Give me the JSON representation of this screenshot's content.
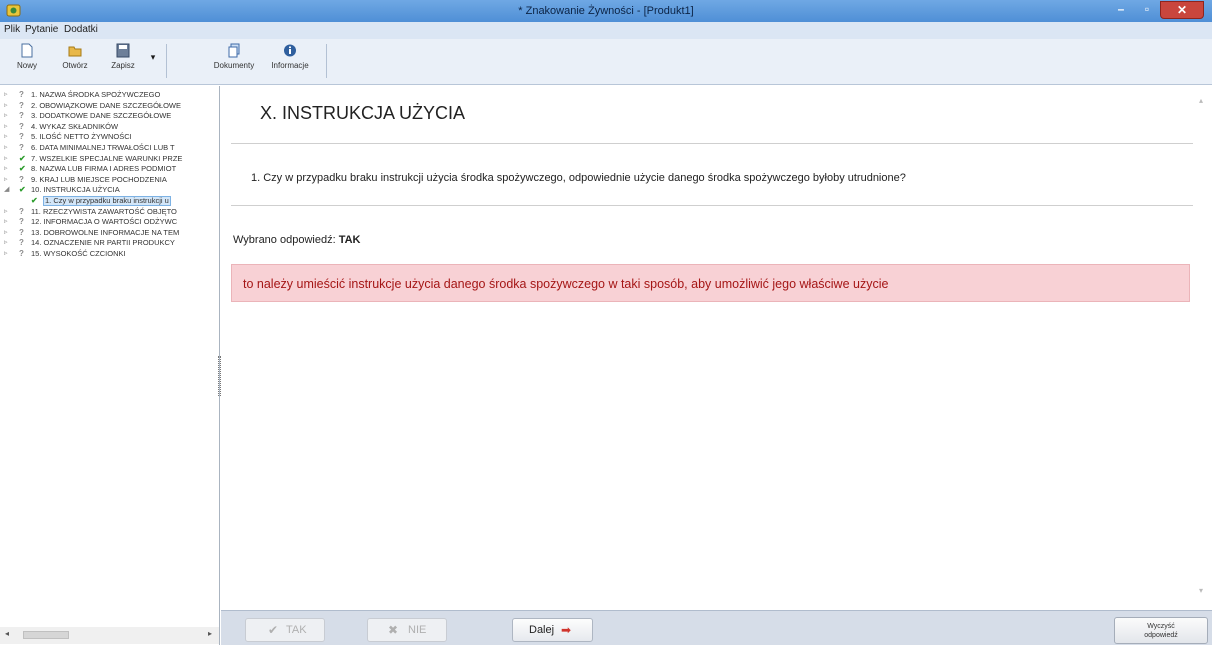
{
  "window": {
    "title": "* Znakowanie Żywności - [Produkt1]",
    "app_icon": "app-icon",
    "minimize": "–",
    "maximize": "▫",
    "close": "✕"
  },
  "menu": {
    "items": [
      "Plik",
      "Pytanie",
      "Dodatki"
    ]
  },
  "toolbar": {
    "buttons": [
      {
        "label": "Nowy",
        "icon": "new-document-icon"
      },
      {
        "label": "Otwórz",
        "icon": "open-folder-icon"
      },
      {
        "label": "Zapisz",
        "icon": "save-icon"
      },
      {
        "label": "Dokumenty",
        "icon": "documents-icon"
      },
      {
        "label": "Informacje",
        "icon": "info-icon"
      }
    ],
    "save_dropdown": "▾"
  },
  "tree": {
    "items": [
      {
        "expander": "▹",
        "mark": "?",
        "status": "q",
        "text": "1. NAZWA ŚRODKA SPOŻYWCZEGO"
      },
      {
        "expander": "▹",
        "mark": "?",
        "status": "q",
        "text": "2. OBOWIĄZKOWE DANE SZCZEGÓŁOWE"
      },
      {
        "expander": "▹",
        "mark": "?",
        "status": "q",
        "text": "3. DODATKOWE DANE SZCZEGÓŁOWE"
      },
      {
        "expander": "▹",
        "mark": "?",
        "status": "q",
        "text": "4. WYKAZ SKŁADNIKÓW"
      },
      {
        "expander": "▹",
        "mark": "?",
        "status": "q",
        "text": "5. ILOŚĆ NETTO ŻYWNOŚCI"
      },
      {
        "expander": "▹",
        "mark": "?",
        "status": "q",
        "text": "6. DATA MINIMALNEJ TRWAŁOŚCI LUB T"
      },
      {
        "expander": "▹",
        "mark": "✔",
        "status": "ok",
        "text": "7. WSZELKIE SPECJALNE WARUNKI PRZE"
      },
      {
        "expander": "▹",
        "mark": "✔",
        "status": "ok",
        "text": "8. NAZWA LUB FIRMA I ADRES PODMIOT"
      },
      {
        "expander": "▹",
        "mark": "?",
        "status": "q",
        "text": "9. KRAJ LUB MIEJSCE POCHODZENIA"
      },
      {
        "expander": "◢",
        "mark": "✔",
        "status": "ok",
        "text": "10. INSTRUKCJA UŻYCIA"
      },
      {
        "expander": "",
        "mark": "✔",
        "status": "ok",
        "text": "1. Czy w przypadku braku instrukcji u",
        "child": true,
        "selected": true
      },
      {
        "expander": "▹",
        "mark": "?",
        "status": "q",
        "text": "11. RZECZYWISTA ZAWARTOŚĆ OBJĘTO"
      },
      {
        "expander": "▹",
        "mark": "?",
        "status": "q",
        "text": "12. INFORMACJA O WARTOŚCI ODŻYWC"
      },
      {
        "expander": "▹",
        "mark": "?",
        "status": "q",
        "text": "13. DOBROWOLNE INFORMACJE NA TEM"
      },
      {
        "expander": "▹",
        "mark": "?",
        "status": "q",
        "text": "14. OZNACZENIE NR PARTII PRODUKCY"
      },
      {
        "expander": "▹",
        "mark": "?",
        "status": "q",
        "text": "15. WYSOKOŚĆ CZCIONKI"
      }
    ],
    "scroll_left": "◂",
    "scroll_right": "▸"
  },
  "content": {
    "heading": "X. INSTRUKCJA UŻYCIA",
    "question": "1.  Czy w przypadku braku instrukcji użycia środka spożywczego, odpowiednie użycie danego środka spożywczego byłoby utrudnione?",
    "answer_label": "Wybrano odpowiedź: ",
    "answer_value": "TAK",
    "result": "to należy umieścić instrukcje użycia danego środka spożywczego w taki sposób, aby umożliwić jego właściwe użycie",
    "scroll_up": "▴",
    "scroll_down": "▾"
  },
  "bottom": {
    "tak": {
      "label": "TAK",
      "icon": "✔"
    },
    "nie": {
      "label": "NIE",
      "icon": "✖"
    },
    "dalej": {
      "label": "Dalej",
      "icon": "➡"
    },
    "zapisz_line1": "Wyczyść",
    "zapisz_line2": "odpowiedź"
  },
  "colors": {
    "result_bg": "#f8d1d5",
    "result_text": "#a51616",
    "check_green": "#2e9d2e",
    "titlebar": "#5f9ddf"
  }
}
